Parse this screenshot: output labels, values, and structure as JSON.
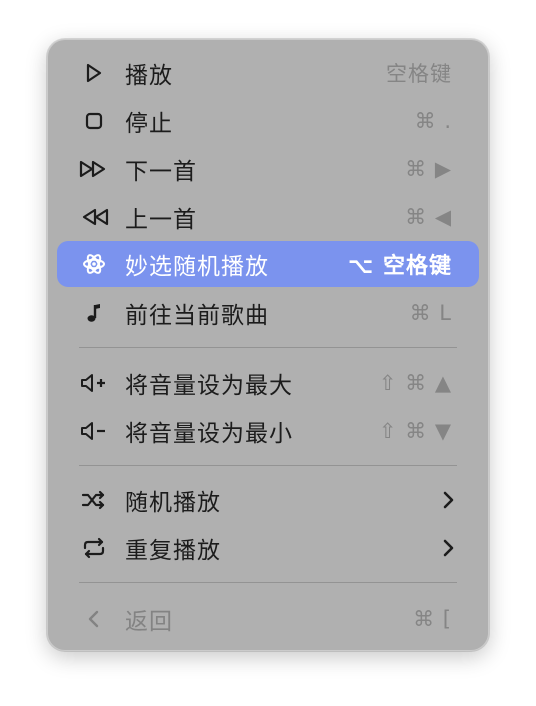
{
  "menu": {
    "items": [
      {
        "label": "播放",
        "shortcut": "空格键",
        "icon": "play-icon"
      },
      {
        "label": "停止",
        "shortcut": "⌘ .",
        "icon": "stop-icon"
      },
      {
        "label": "下一首",
        "shortcut": "⌘ ▶",
        "icon": "next-track-icon"
      },
      {
        "label": "上一首",
        "shortcut": "⌘ ◀",
        "icon": "previous-track-icon"
      },
      {
        "label": "妙选随机播放",
        "shortcut": "⌥ 空格键",
        "icon": "atom-icon",
        "highlighted": true
      },
      {
        "label": "前往当前歌曲",
        "shortcut": "⌘ L",
        "icon": "music-note-icon"
      },
      {
        "label": "将音量设为最大",
        "shortcut": "⇧ ⌘ ▲",
        "icon": "volume-up-icon"
      },
      {
        "label": "将音量设为最小",
        "shortcut": "⇧ ⌘ ▼",
        "icon": "volume-down-icon"
      },
      {
        "label": "随机播放",
        "icon": "shuffle-icon",
        "submenu": true
      },
      {
        "label": "重复播放",
        "icon": "repeat-icon",
        "submenu": true
      },
      {
        "label": "返回",
        "shortcut": "⌘ [",
        "icon": "back-icon",
        "disabled": true
      }
    ]
  },
  "colors": {
    "menu_background": "#b0b0b0",
    "highlight": "#7b93ee",
    "text": "#1c1c1c",
    "shortcut_text": "#858585",
    "disabled_text": "#838383"
  }
}
